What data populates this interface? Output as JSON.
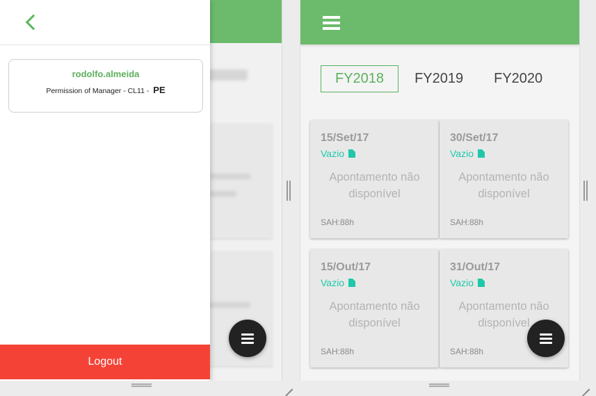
{
  "left_panel": {
    "drawer": {
      "username": "rodolfo.almeida",
      "permission_text": "Permission of Manager - CL11 -",
      "role_code": "PE",
      "logout_label": "Logout"
    }
  },
  "right_panel": {
    "fiscal_years": [
      "FY2018",
      "FY2019",
      "FY2020"
    ],
    "selected_year": "FY2018",
    "cards": [
      {
        "date": "15/Set/17",
        "status": "Vazio",
        "message": "Apontamento não disponível",
        "sah": "SAH:88h"
      },
      {
        "date": "30/Set/17",
        "status": "Vazio",
        "message": "Apontamento não disponível",
        "sah": "SAH:88h"
      },
      {
        "date": "15/Out/17",
        "status": "Vazio",
        "message": "Apontamento não disponível",
        "sah": "SAH:88h"
      },
      {
        "date": "31/Out/17",
        "status": "Vazio",
        "message": "Apontamento não disponível",
        "sah": "SAH:88h"
      }
    ]
  },
  "colors": {
    "header_green": "#6cbb6d",
    "accent_green": "#5cb05d",
    "logout_red": "#f44336",
    "status_teal": "#1ec8a8",
    "fab_dark": "#222222"
  },
  "icons": [
    "back-chevron-icon",
    "menu-icon",
    "document-icon"
  ]
}
